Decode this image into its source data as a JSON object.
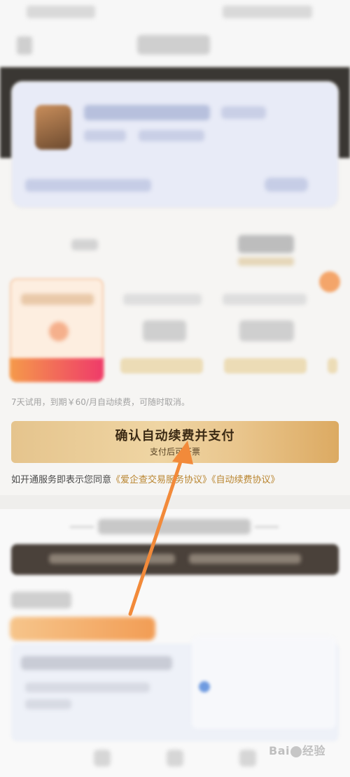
{
  "colors": {
    "confirm_gradient": [
      "#e5c48d",
      "#efd5a3",
      "#dcaa62"
    ],
    "link": "#b9852f",
    "selected_plan_bar": [
      "#f59a4a",
      "#ef3a6a"
    ],
    "annotation_arrow": "#f28a3a"
  },
  "notice_text": "7天试用，到期￥60/月自动续费，可随时取消。",
  "confirm_button": {
    "title": "确认自动续费并支付",
    "subtitle": "支付后可开票"
  },
  "agreement": {
    "prefix": "如开通服务即表示您同意",
    "link_service": "《爱企查交易服务协议》",
    "link_autorenew": "《自动续费协议》"
  },
  "watermark": {
    "text_left": "Bai",
    "text_right": "经验"
  },
  "icons": {
    "back": "back-arrow-icon",
    "annotation": "arrow-annotation-icon",
    "watermark": "baidu-paw-icon"
  }
}
